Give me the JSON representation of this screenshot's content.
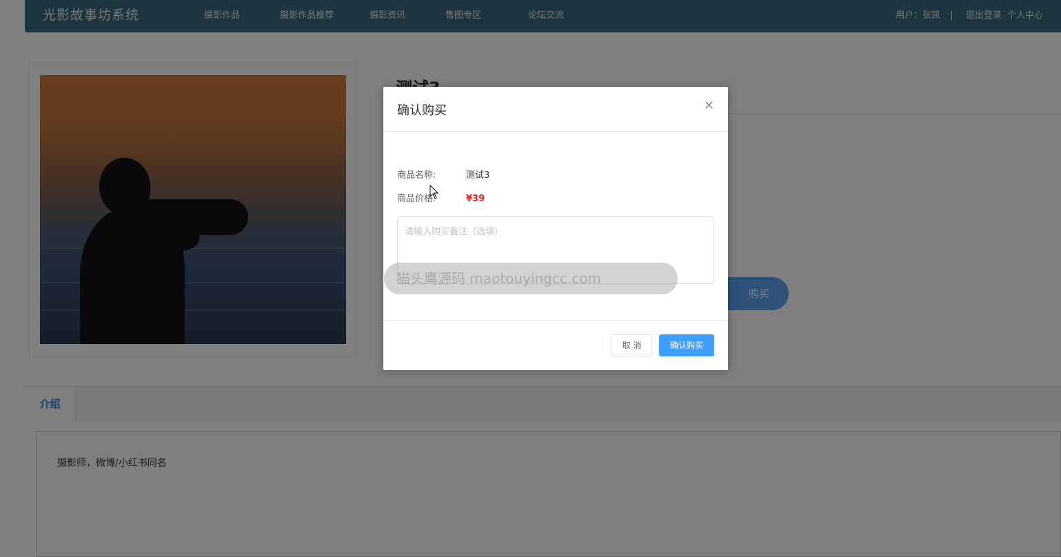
{
  "app": {
    "brand": "光影故事坊系统"
  },
  "nav": {
    "items": [
      {
        "label": "摄影作品"
      },
      {
        "label": "摄影作品推荐"
      },
      {
        "label": "摄影资讯"
      },
      {
        "label": "售图专区"
      },
      {
        "label": "论坛交流"
      }
    ]
  },
  "user": {
    "label": "用户：张凯",
    "separator": "|",
    "logout": "退出登录",
    "profile": "个人中心"
  },
  "product": {
    "title": "测试3",
    "buy_button_partial": "购买",
    "image_icon": "photographer-silhouette-image"
  },
  "tabs": {
    "active": "介绍"
  },
  "intro": {
    "text": "摄影师，微博/小红书同名"
  },
  "modal": {
    "title": "确认购买",
    "close_icon": "close-icon",
    "name_label": "商品名称:",
    "name_value": "测试3",
    "price_label": "商品价格:",
    "price_value": "¥39",
    "remark_placeholder": "请输入购买备注（选填）",
    "cancel_label": "取 消",
    "confirm_label": "确认购买"
  },
  "watermark": {
    "text": "猫头鹰源码 maotouyingcc.com"
  },
  "colors": {
    "topbar": "#3a6a7e",
    "primary": "#409eff",
    "price": "#e02424",
    "tab_active": "#2d7bd8"
  }
}
